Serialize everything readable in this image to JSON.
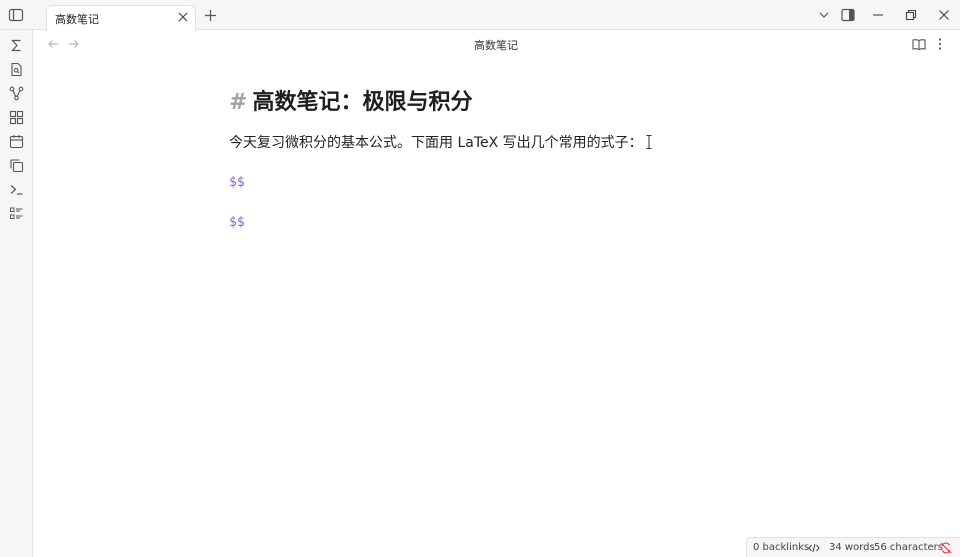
{
  "tab": {
    "title": "高数笔记"
  },
  "header": {
    "title": "高数笔记"
  },
  "document": {
    "heading_marker": "#",
    "heading": "高数笔记：极限与积分",
    "paragraph": "今天复习微积分的基本公式。下面用 LaTeX 写出几个常用的式子：",
    "math_open": "$$",
    "math_close": "$$"
  },
  "status": {
    "backlinks": "0 backlinks",
    "words": "34 words",
    "characters": "56 characters"
  },
  "icons": {
    "sidebar_toggle": "sidebar-toggle-icon",
    "tab_close": "close-icon",
    "new_tab": "plus-icon",
    "ribbon": [
      "sigma-icon",
      "file-search-icon",
      "graph-icon",
      "blocks-icon",
      "calendar-icon",
      "copy-icon",
      "terminal-icon",
      "list-icon"
    ],
    "window": [
      "chevron-down-icon",
      "right-sidebar-icon",
      "minimize-icon",
      "restore-icon",
      "close-window-icon"
    ],
    "header": [
      "reading-mode-icon",
      "more-options-icon"
    ],
    "status": [
      "code-icon",
      "sync-off-icon"
    ]
  },
  "colors": {
    "accent": "#8a63d2",
    "muted": "#a3a3a3",
    "error": "#e0384b"
  }
}
